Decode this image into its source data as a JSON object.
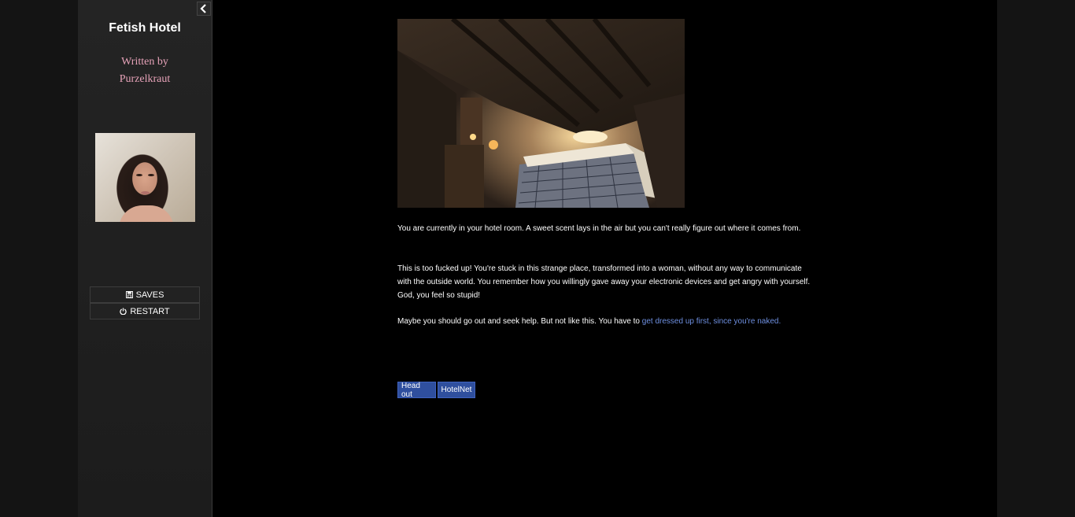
{
  "sidebar": {
    "title": "Fetish Hotel",
    "byline_line1": "Written by",
    "byline_line2": "Purzelkraut",
    "collapse_icon": "chevron-left-icon",
    "menu": {
      "saves_label": "SAVES",
      "restart_label": "RESTART"
    }
  },
  "passage": {
    "paragraph1": "You are currently in your hotel room. A sweet scent lays in the air but you can't really figure out where it comes from.",
    "paragraph2": "This is too fucked up! You're stuck in this strange place, transformed into a woman, without any way to communicate with the outside world. You remember how you willingly gave away your electronic devices and get angry with yourself. God, you feel so stupid!",
    "paragraph3_prefix": "Maybe you should go out and seek help. But not like this. You have to ",
    "paragraph3_link": "get dressed up first, since you're naked."
  },
  "actions": {
    "head_out": "Head out",
    "hotelnet": "HotelNet"
  },
  "colors": {
    "link": "#6e8fe0",
    "button": "#2f4f9e",
    "byline": "#e6a2b8"
  }
}
